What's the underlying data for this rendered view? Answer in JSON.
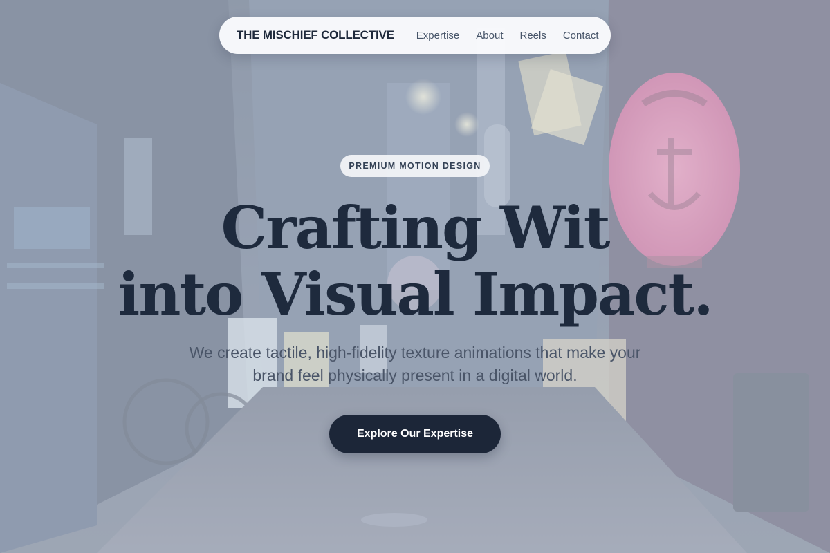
{
  "nav": {
    "brand": "THE MISCHIEF COLLECTIVE",
    "links": [
      "Expertise",
      "About",
      "Reels",
      "Contact"
    ]
  },
  "hero": {
    "badge": "PREMIUM MOTION DESIGN",
    "headline_line1": "Crafting Wit",
    "headline_line2": "into Visual Impact.",
    "subheadline": "We create tactile, high-fidelity texture animations that make your brand feel physically present in a digital world.",
    "cta_label": "Explore Our Expertise"
  },
  "colors": {
    "text_dark": "#1e2a3d",
    "cta_bg": "#1c2638",
    "lantern_pink": "#e0528f",
    "overlay": "#d6dce6"
  }
}
